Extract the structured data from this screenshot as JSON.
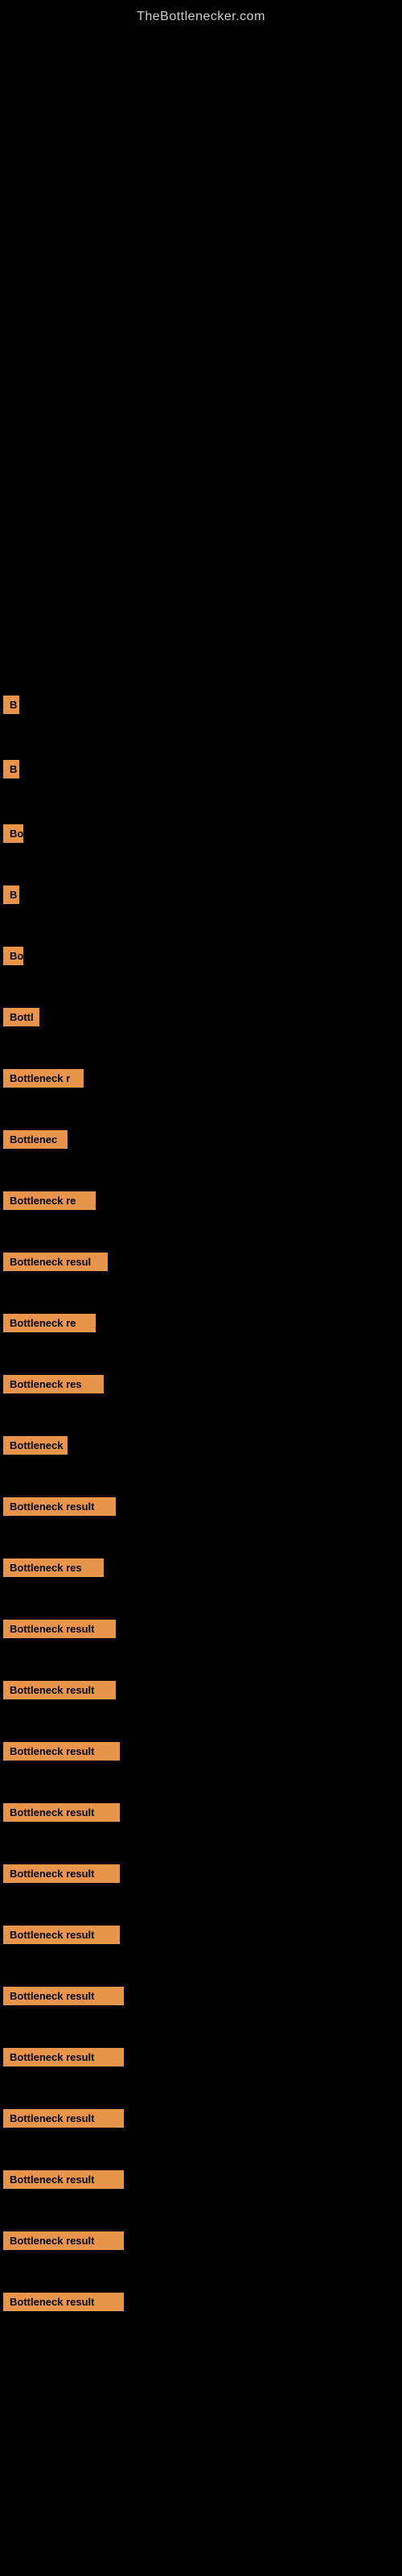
{
  "site": {
    "title": "TheBottlenecker.com"
  },
  "bars": [
    {
      "label": "B",
      "width_class": "bar-w-20",
      "gap_before": 820
    },
    {
      "label": "B",
      "width_class": "bar-w-20",
      "gap_before": 40
    },
    {
      "label": "Bo",
      "width_class": "bar-w-25",
      "gap_before": 40
    },
    {
      "label": "B",
      "width_class": "bar-w-20",
      "gap_before": 36
    },
    {
      "label": "Bo",
      "width_class": "bar-w-25",
      "gap_before": 36
    },
    {
      "label": "Bottl",
      "width_class": "bar-w-45",
      "gap_before": 36
    },
    {
      "label": "Bottleneck r",
      "width_class": "bar-w-100",
      "gap_before": 36
    },
    {
      "label": "Bottlenec",
      "width_class": "bar-w-80",
      "gap_before": 36
    },
    {
      "label": "Bottleneck re",
      "width_class": "bar-w-115",
      "gap_before": 36
    },
    {
      "label": "Bottleneck resul",
      "width_class": "bar-w-130",
      "gap_before": 36
    },
    {
      "label": "Bottleneck re",
      "width_class": "bar-w-115",
      "gap_before": 36
    },
    {
      "label": "Bottleneck res",
      "width_class": "bar-w-125",
      "gap_before": 36
    },
    {
      "label": "Bottleneck",
      "width_class": "bar-w-80",
      "gap_before": 36
    },
    {
      "label": "Bottleneck result",
      "width_class": "bar-w-140",
      "gap_before": 36
    },
    {
      "label": "Bottleneck res",
      "width_class": "bar-w-125",
      "gap_before": 36
    },
    {
      "label": "Bottleneck result",
      "width_class": "bar-w-140",
      "gap_before": 36
    },
    {
      "label": "Bottleneck result",
      "width_class": "bar-w-140",
      "gap_before": 36
    },
    {
      "label": "Bottleneck result",
      "width_class": "bar-w-145",
      "gap_before": 36
    },
    {
      "label": "Bottleneck result",
      "width_class": "bar-w-145",
      "gap_before": 36
    },
    {
      "label": "Bottleneck result",
      "width_class": "bar-w-145",
      "gap_before": 36
    },
    {
      "label": "Bottleneck result",
      "width_class": "bar-w-145",
      "gap_before": 36
    },
    {
      "label": "Bottleneck result",
      "width_class": "bar-w-150",
      "gap_before": 36
    },
    {
      "label": "Bottleneck result",
      "width_class": "bar-w-150",
      "gap_before": 36
    },
    {
      "label": "Bottleneck result",
      "width_class": "bar-w-150",
      "gap_before": 36
    },
    {
      "label": "Bottleneck result",
      "width_class": "bar-w-150",
      "gap_before": 36
    },
    {
      "label": "Bottleneck result",
      "width_class": "bar-w-150",
      "gap_before": 36
    },
    {
      "label": "Bottleneck result",
      "width_class": "bar-w-150",
      "gap_before": 36
    }
  ]
}
